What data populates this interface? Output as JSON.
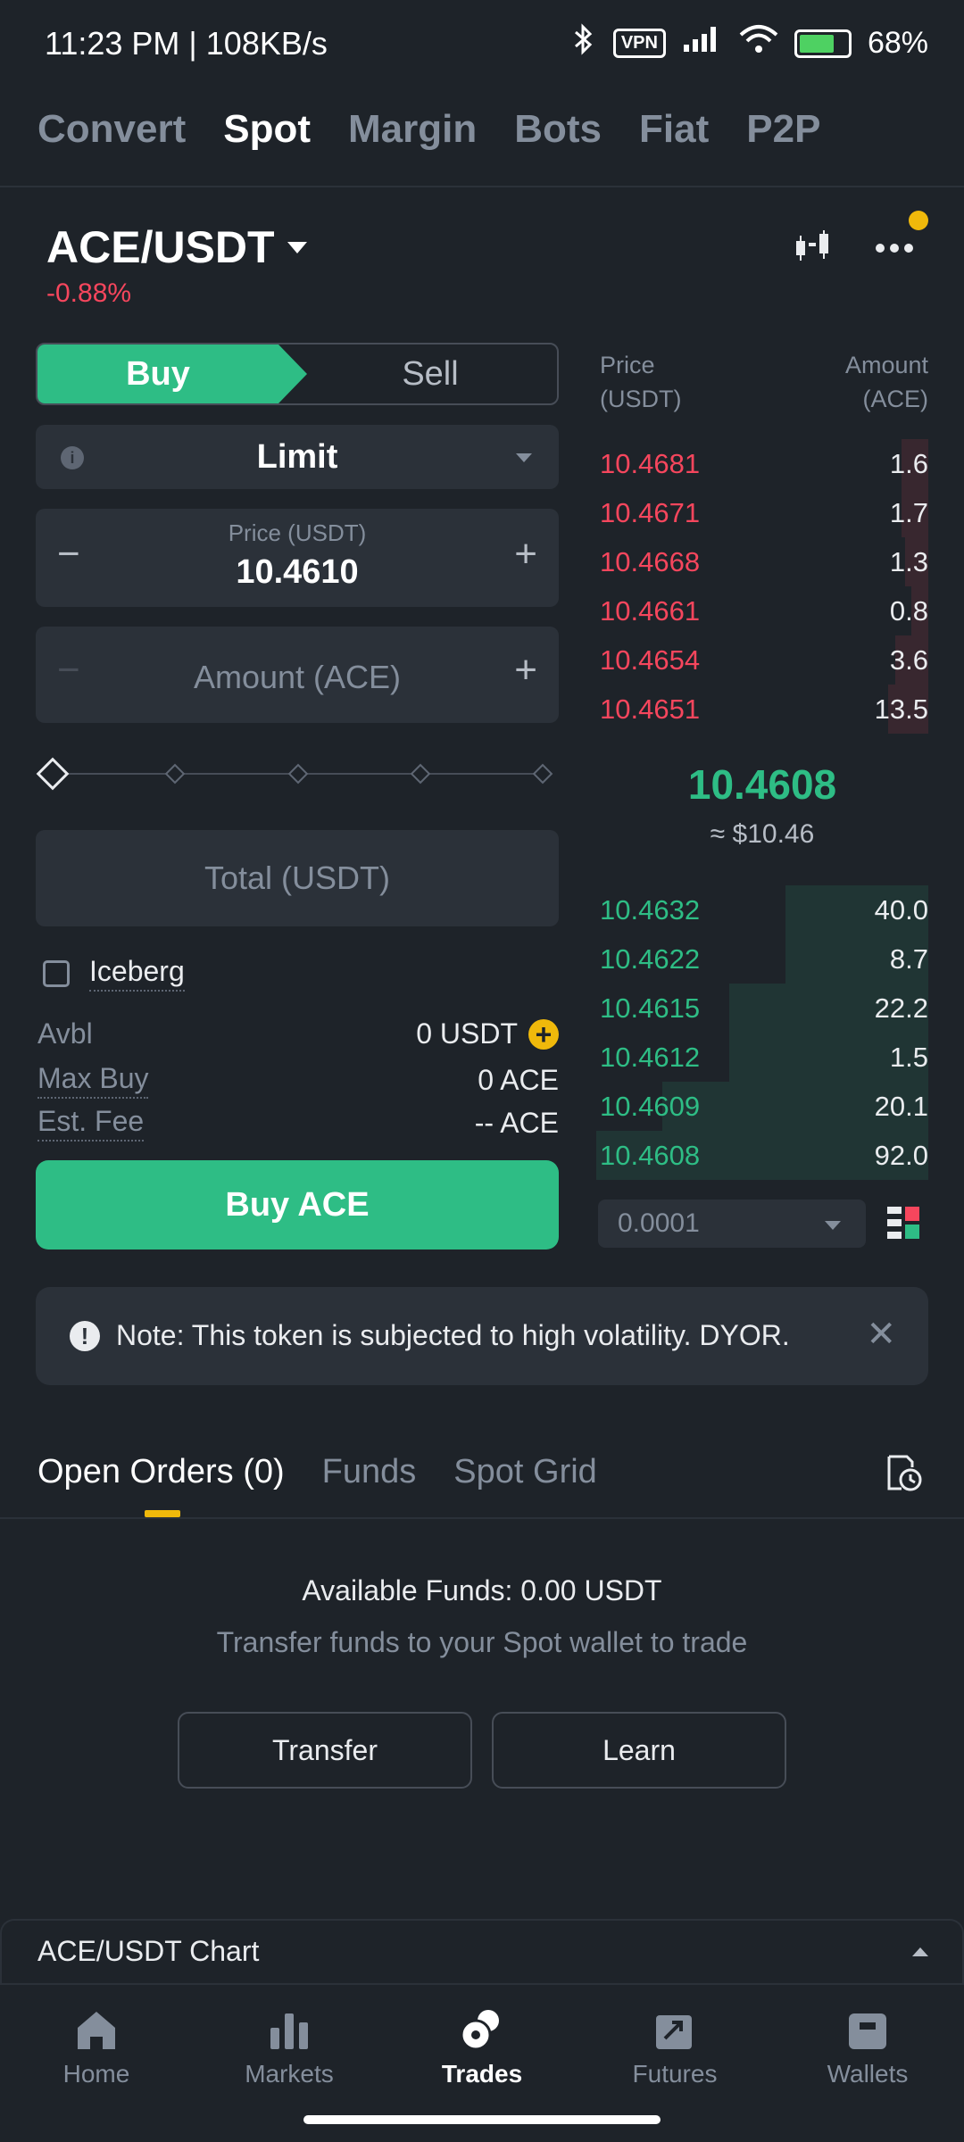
{
  "status_bar": {
    "time": "11:23 PM | 108KB/s",
    "vpn": "VPN",
    "battery": "68%"
  },
  "top_tabs": [
    {
      "label": "Convert",
      "active": false
    },
    {
      "label": "Spot",
      "active": true
    },
    {
      "label": "Margin",
      "active": false
    },
    {
      "label": "Bots",
      "active": false
    },
    {
      "label": "Fiat",
      "active": false
    },
    {
      "label": "P2P",
      "active": false
    }
  ],
  "pair": {
    "symbol": "ACE/USDT",
    "change": "-0.88%"
  },
  "form": {
    "buy_label": "Buy",
    "sell_label": "Sell",
    "order_type": "Limit",
    "price_label": "Price (USDT)",
    "price_value": "10.4610",
    "amount_placeholder": "Amount (ACE)",
    "total_placeholder": "Total (USDT)",
    "iceberg_label": "Iceberg",
    "avbl_label": "Avbl",
    "avbl_value": "0 USDT",
    "max_buy_label": "Max Buy",
    "max_buy_value": "0 ACE",
    "est_fee_label": "Est. Fee",
    "est_fee_value": "-- ACE",
    "submit_label": "Buy ACE",
    "slider_level": 0
  },
  "orderbook": {
    "price_header": "Price",
    "price_unit": "(USDT)",
    "amount_header": "Amount",
    "amount_unit": "(ACE)",
    "asks": [
      {
        "price": "10.4681",
        "amount": "1.6",
        "depth": 0.08
      },
      {
        "price": "10.4671",
        "amount": "1.7",
        "depth": 0.08
      },
      {
        "price": "10.4668",
        "amount": "1.3",
        "depth": 0.07
      },
      {
        "price": "10.4661",
        "amount": "0.8",
        "depth": 0.05
      },
      {
        "price": "10.4654",
        "amount": "3.6",
        "depth": 0.1
      },
      {
        "price": "10.4651",
        "amount": "13.5",
        "depth": 0.12
      }
    ],
    "last_price": "10.4608",
    "last_usd": "≈ $10.46",
    "bids": [
      {
        "price": "10.4632",
        "amount": "40.0",
        "depth": 0.43
      },
      {
        "price": "10.4622",
        "amount": "8.7",
        "depth": 0.43
      },
      {
        "price": "10.4615",
        "amount": "22.2",
        "depth": 0.6
      },
      {
        "price": "10.4612",
        "amount": "1.5",
        "depth": 0.6
      },
      {
        "price": "10.4609",
        "amount": "20.1",
        "depth": 0.8
      },
      {
        "price": "10.4608",
        "amount": "92.0",
        "depth": 1.0
      }
    ],
    "tick_size": "0.0001"
  },
  "note": {
    "text": "Note: This token is subjected to high volatility. DYOR."
  },
  "lower_tabs": [
    {
      "label": "Open Orders (0)",
      "active": true
    },
    {
      "label": "Funds",
      "active": false
    },
    {
      "label": "Spot Grid",
      "active": false
    }
  ],
  "empty_state": {
    "title": "Available Funds: 0.00 USDT",
    "subtitle": "Transfer funds to your Spot wallet to trade",
    "transfer_label": "Transfer",
    "learn_label": "Learn"
  },
  "chart_drawer": {
    "title": "ACE/USDT Chart"
  },
  "bottom_nav": [
    {
      "label": "Home",
      "icon": "home-icon",
      "active": false
    },
    {
      "label": "Markets",
      "icon": "markets-icon",
      "active": false
    },
    {
      "label": "Trades",
      "icon": "trades-icon",
      "active": true
    },
    {
      "label": "Futures",
      "icon": "futures-icon",
      "active": false
    },
    {
      "label": "Wallets",
      "icon": "wallets-icon",
      "active": false
    }
  ],
  "colors": {
    "buy": "#2ebd85",
    "sell": "#f6465d",
    "accent": "#f0b90b",
    "bg": "#1e2329",
    "panel": "#2b3139"
  }
}
